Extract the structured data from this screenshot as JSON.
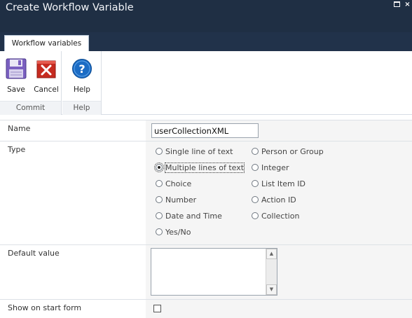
{
  "window": {
    "title": "Create Workflow Variable"
  },
  "ribbon": {
    "tab_label": "Workflow variables",
    "groups": [
      {
        "label": "Commit",
        "buttons": [
          {
            "label": "Save",
            "icon": "save-icon"
          },
          {
            "label": "Cancel",
            "icon": "cancel-icon"
          }
        ]
      },
      {
        "label": "Help",
        "buttons": [
          {
            "label": "Help",
            "icon": "help-icon"
          }
        ]
      }
    ]
  },
  "form": {
    "name": {
      "label": "Name",
      "value": "userCollectionXML"
    },
    "type": {
      "label": "Type",
      "selected": "Multiple lines of text",
      "options_left": [
        "Single line of text",
        "Multiple lines of text",
        "Choice",
        "Number",
        "Date and Time",
        "Yes/No"
      ],
      "options_right": [
        "Person or Group",
        "Integer",
        "List Item ID",
        "Action ID",
        "Collection"
      ]
    },
    "default_value": {
      "label": "Default value",
      "value": ""
    },
    "show_on_start_form": {
      "label": "Show on start form",
      "checked": false
    }
  },
  "colors": {
    "title_bar": "#1f2f44",
    "field_background": "#f5f5f5",
    "cancel_red": "#c62b20",
    "help_blue": "#1c6cc4",
    "save_purple": "#7a5fc0"
  }
}
